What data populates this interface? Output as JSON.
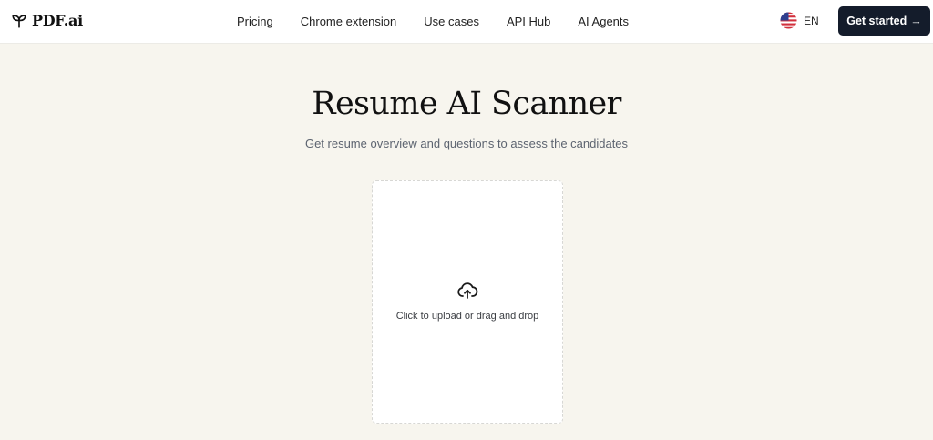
{
  "header": {
    "logo_text": "PDF.ai",
    "logo_icon": "sprout-icon",
    "nav": [
      {
        "label": "Pricing"
      },
      {
        "label": "Chrome extension"
      },
      {
        "label": "Use cases"
      },
      {
        "label": "API Hub"
      },
      {
        "label": "AI Agents"
      }
    ],
    "language": {
      "code": "EN",
      "flag_icon": "us-flag-icon"
    },
    "cta_label": "Get started",
    "cta_arrow": "→",
    "cta_color": "#141c2b"
  },
  "hero": {
    "title": "Resume AI Scanner",
    "subtitle": "Get resume overview and questions to assess the candidates"
  },
  "upload": {
    "icon": "cloud-upload-icon",
    "label": "Click to upload or drag and drop"
  },
  "colors": {
    "page_background": "#f7f5ee",
    "header_background": "#ffffff"
  }
}
